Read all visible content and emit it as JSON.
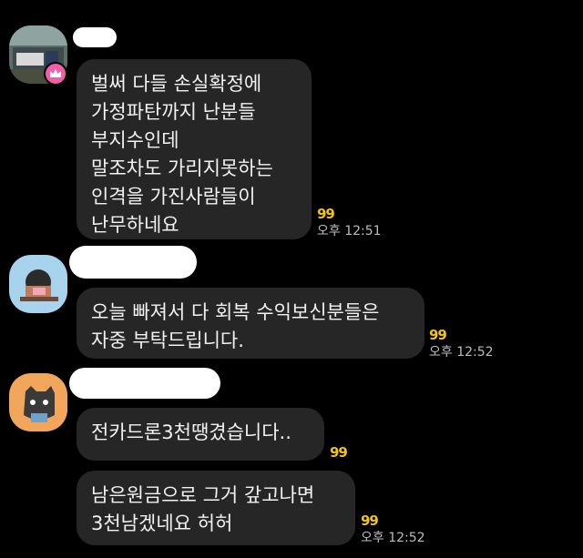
{
  "messages": [
    {
      "text": "벌써 다들 손실확정에\n가정파탄까지 난분들\n부지수인데\n말조차도 가리지못하는\n인격을 가진사람들이\n난무하네요",
      "indicator": "99",
      "time": "오후 12:51"
    },
    {
      "text": "오늘 빠져서 다 회복 수익보신분들은\n자중 부탁드립니다.",
      "indicator": "99",
      "time": "오후 12:52"
    },
    {
      "text": "전카드론3천땡겼습니다..",
      "indicator": "99",
      "time": ""
    },
    {
      "text": "남은원금으로 그거 갚고나면\n3천남겠네요 허허",
      "indicator": "99",
      "time": "오후 12:52"
    }
  ],
  "colors": {
    "background": "#000000",
    "bubble": "#262626",
    "indicator": "#f2c511",
    "crown_badge": "#f05fa8"
  },
  "icons": [
    "crown-badge-icon"
  ]
}
